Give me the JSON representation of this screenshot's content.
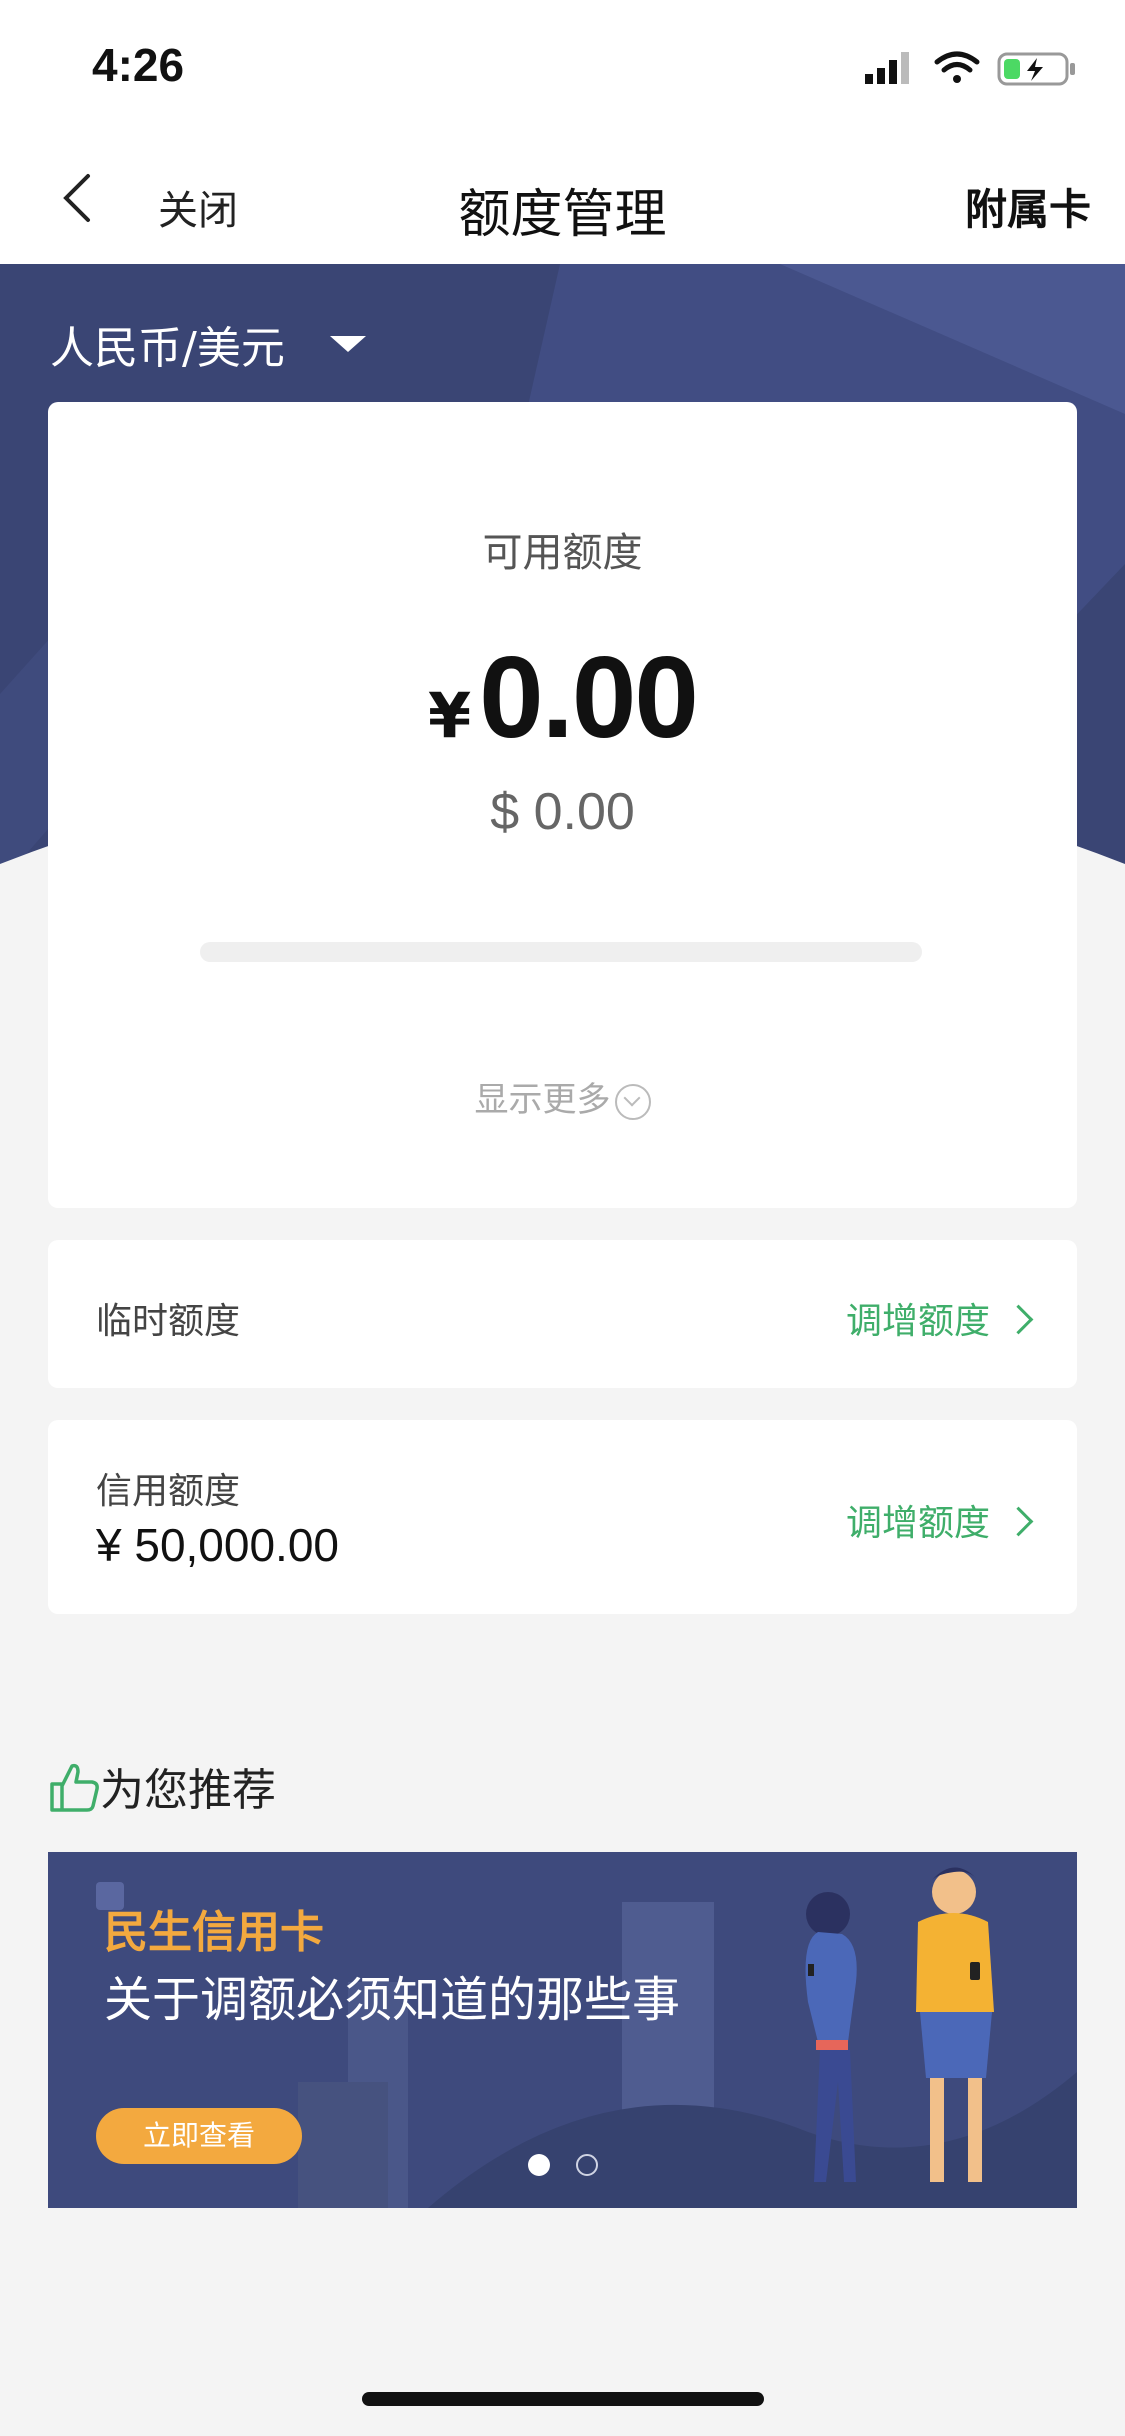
{
  "status_bar": {
    "time": "4:26"
  },
  "nav": {
    "close_label": "关闭",
    "title": "额度管理",
    "right_label": "附属卡"
  },
  "currency_selector": {
    "label": "人民币/美元"
  },
  "available": {
    "label": "可用额度",
    "currency_symbol": "¥",
    "amount": "0.00",
    "usd_amount": "$ 0.00",
    "usage_fraction": 0,
    "show_more": "显示更多"
  },
  "temporary_limit": {
    "label": "临时额度",
    "action": "调增额度"
  },
  "credit_limit": {
    "label": "信用额度",
    "value": "¥ 50,000.00",
    "action": "调增额度"
  },
  "recommend": {
    "title": "为您推荐",
    "banner": {
      "brand": "民生信用卡",
      "headline": "关于调额必须知道的那些事",
      "cta": "立即查看"
    },
    "carousel": {
      "pages": 2,
      "active": 1
    }
  },
  "colors": {
    "accent_green": "#3fae6a",
    "hero_blue": "#3b4678",
    "cta_orange": "#f3a93f"
  }
}
